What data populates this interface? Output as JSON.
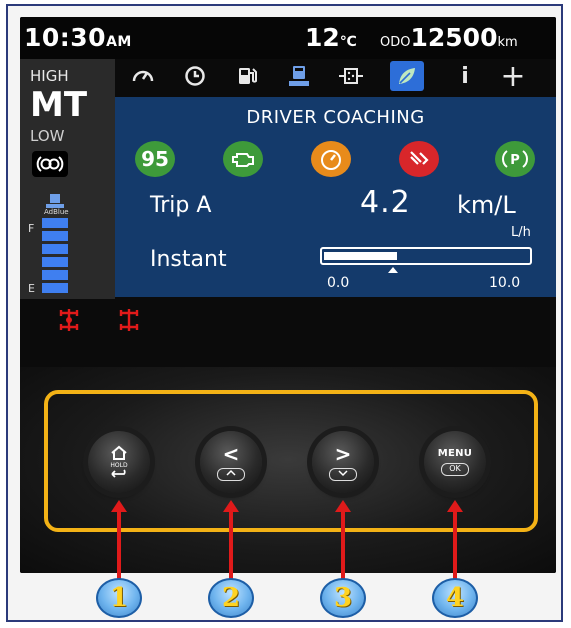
{
  "status": {
    "time": "10:30",
    "time_suffix": "AM",
    "temperature": "12",
    "temperature_unit": "℃",
    "odo_label": "ODO",
    "odo_value": "12500",
    "odo_unit": "km"
  },
  "drive_mode": {
    "high_label": "HIGH",
    "mode": "MT",
    "low_label": "LOW"
  },
  "fuel_gauge": {
    "adblue_label": "AdBlue",
    "full_label": "F",
    "empty_label": "E"
  },
  "icon_strip": [
    {
      "icon": "speedometer-icon"
    },
    {
      "icon": "clock-icon"
    },
    {
      "icon": "fuel-pump-icon"
    },
    {
      "icon": "adblue-icon"
    },
    {
      "icon": "dpf-icon"
    },
    {
      "icon": "leaf-eco-icon",
      "active": true
    },
    {
      "icon": "info-icon",
      "glyph": "i"
    },
    {
      "icon": "plus-icon",
      "glyph": "+"
    }
  ],
  "panel": {
    "title": "DRIVER COACHING",
    "score": "95",
    "trip_label": "Trip A",
    "trip_value": "4.2",
    "trip_unit": "km/L",
    "instant_unit": "L/h",
    "instant_label": "Instant",
    "instant_fraction": 0.36,
    "scale_min": "0.0",
    "scale_max": "10.0"
  },
  "buttons": [
    {
      "id": "home-back",
      "sub": "HOLD"
    },
    {
      "id": "left-up",
      "main": "<"
    },
    {
      "id": "right-down",
      "main": ">"
    },
    {
      "id": "menu-ok",
      "main": "MENU",
      "sub": "OK"
    }
  ],
  "callouts": [
    "1",
    "2",
    "3",
    "4"
  ],
  "colors": {
    "panel": "#143a6b",
    "highlight": "#f3b216",
    "arrow": "#e01a1a",
    "coach_green": "#3e9a3a",
    "coach_orange": "#e88b1b",
    "coach_red": "#d8262a"
  }
}
